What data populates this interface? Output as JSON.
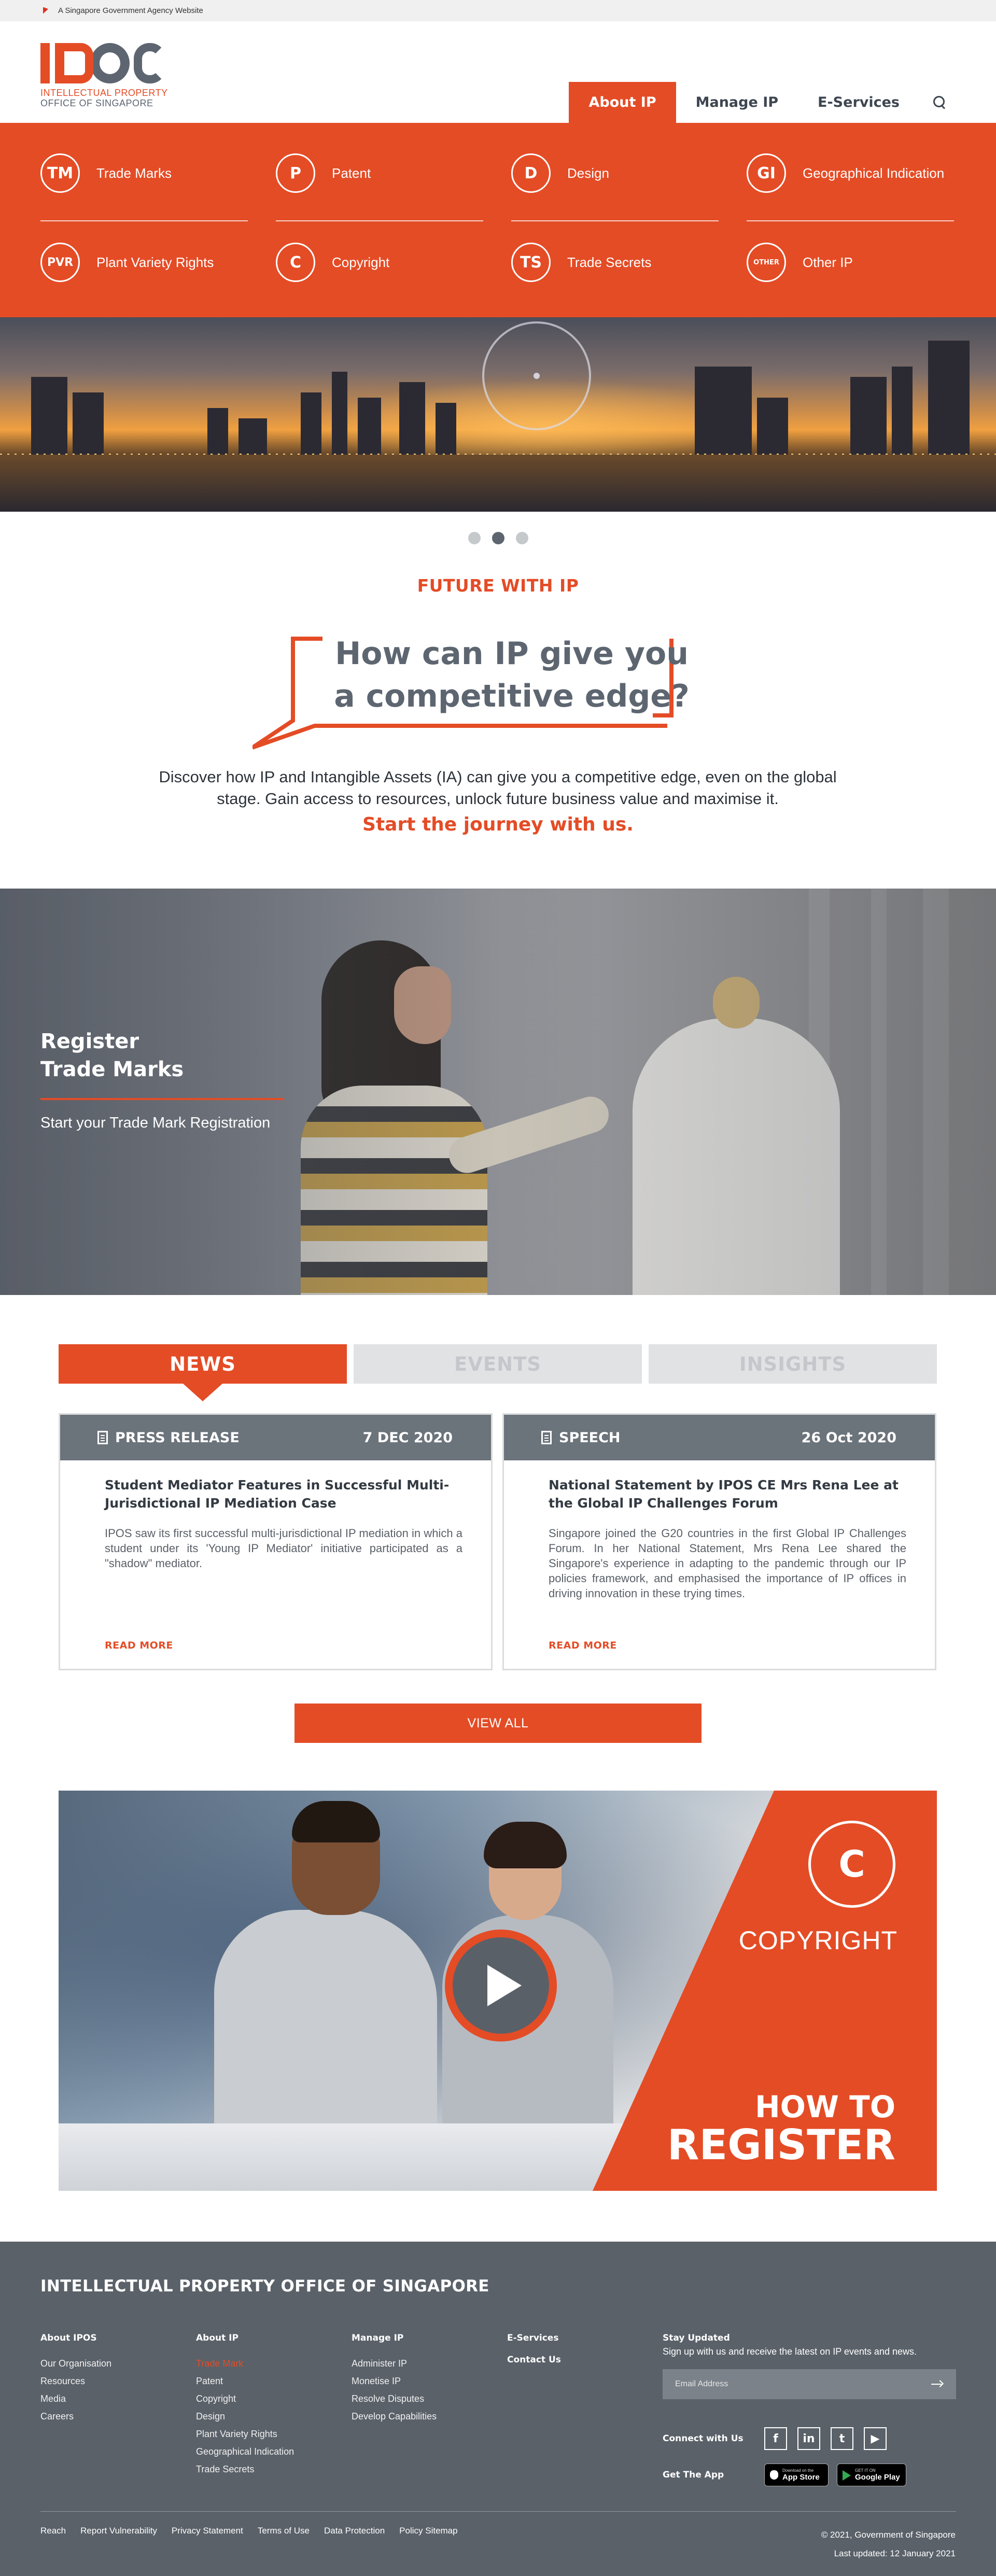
{
  "gov_banner": {
    "text": "A Singapore Government Agency Website"
  },
  "logo": {
    "letters": "IPOS",
    "line1": "INTELLECTUAL PROPERTY",
    "line2": "OFFICE OF SINGAPORE"
  },
  "nav": {
    "items": [
      "About IP",
      "Manage IP",
      "E-Services"
    ],
    "active": "About IP",
    "search_icon": "search-icon"
  },
  "mega_menu": {
    "items": [
      {
        "badge": "TM",
        "label": "Trade Marks"
      },
      {
        "badge": "P",
        "label": "Patent"
      },
      {
        "badge": "D",
        "label": "Design"
      },
      {
        "badge": "GI",
        "label": "Geographical Indication"
      },
      {
        "badge": "PVR",
        "label": "Plant Variety Rights"
      },
      {
        "badge": "C",
        "label": "Copyright"
      },
      {
        "badge": "TS",
        "label": "Trade Secrets"
      },
      {
        "badge": "OTHER",
        "label": "Other IP"
      }
    ]
  },
  "carousel": {
    "slides": 3,
    "active_index": 1
  },
  "future": {
    "kicker": "FUTURE WITH IP",
    "headline_line1": "How can IP give you",
    "headline_line2": "a competitive edge?",
    "description": "Discover how IP and Intangible Assets (IA) can give you a competitive edge, even on the global stage. Gain access to resources, unlock future business value and maximise it.",
    "cta": "Start the journey with us."
  },
  "trade_marks_banner": {
    "title_line1": "Register",
    "title_line2": "Trade Marks",
    "subtitle": "Start your Trade Mark Registration"
  },
  "tabs": {
    "items": [
      "NEWS",
      "EVENTS",
      "INSIGHTS"
    ],
    "active": "NEWS"
  },
  "news": [
    {
      "type": "PRESS RELEASE",
      "date": "7 DEC 2020",
      "title": "Student Mediator Features in Successful Multi-Jurisdictional IP Mediation Case",
      "body": "IPOS saw its first successful multi-jurisdictional IP mediation in which a student under its 'Young IP Mediator' initiative participated as a \"shadow\" mediator.",
      "read_more": "READ MORE"
    },
    {
      "type": "SPEECH",
      "date": "26 Oct 2020",
      "title": "National Statement by IPOS CE Mrs Rena Lee at the Global IP Challenges Forum",
      "body": "Singapore joined the G20 countries in the first Global IP Challenges Forum. In her National Statement, Mrs Rena Lee shared the Singapore's experience in adapting to the pandemic through our IP policies framework, and emphasised the importance of IP offices in driving innovation in these trying times.",
      "read_more": "READ MORE"
    }
  ],
  "view_all": "VIEW ALL",
  "video_promo": {
    "badge": "C",
    "label": "COPYRIGHT",
    "how_to": "HOW TO",
    "register": "REGISTER"
  },
  "footer": {
    "title": "INTELLECTUAL PROPERTY OFFICE OF SINGAPORE",
    "columns": [
      {
        "heading": "About IPOS",
        "links": [
          "Our Organisation",
          "Resources",
          "Media",
          "Careers"
        ]
      },
      {
        "heading": "About IP",
        "links": [
          "Trade Mark",
          "Patent",
          "Copyright",
          "Design",
          "Plant Variety Rights",
          "Geographical Indication",
          "Trade Secrets"
        ]
      },
      {
        "heading": "Manage IP",
        "links": [
          "Administer IP",
          "Monetise IP",
          "Resolve Disputes",
          "Develop Capabilities"
        ]
      },
      {
        "heading": "E-Services",
        "links": []
      }
    ],
    "contact_us": "Contact Us",
    "stay_updated": {
      "heading": "Stay Updated",
      "text": "Sign up with us and receive the latest on IP events and news.",
      "email_placeholder": "Email Address"
    },
    "connect_heading": "Connect with Us",
    "social": [
      "f",
      "in",
      "t",
      "▶"
    ],
    "get_app_heading": "Get The App",
    "app_store": {
      "small": "Download on the",
      "big": "App Store"
    },
    "google_play": {
      "small": "GET IT ON",
      "big": "Google Play"
    },
    "bottom_links": [
      "Reach",
      "Report Vulnerability",
      "Privacy Statement",
      "Terms of Use",
      "Data Protection",
      "Policy Sitemap"
    ],
    "copyright": "© 2021, Government of Singapore",
    "last_updated": "Last updated: 12 January 2021"
  },
  "colors": {
    "accent": "#e44c26",
    "slate": "#5d6670",
    "footer_bg": "#5a6169"
  }
}
